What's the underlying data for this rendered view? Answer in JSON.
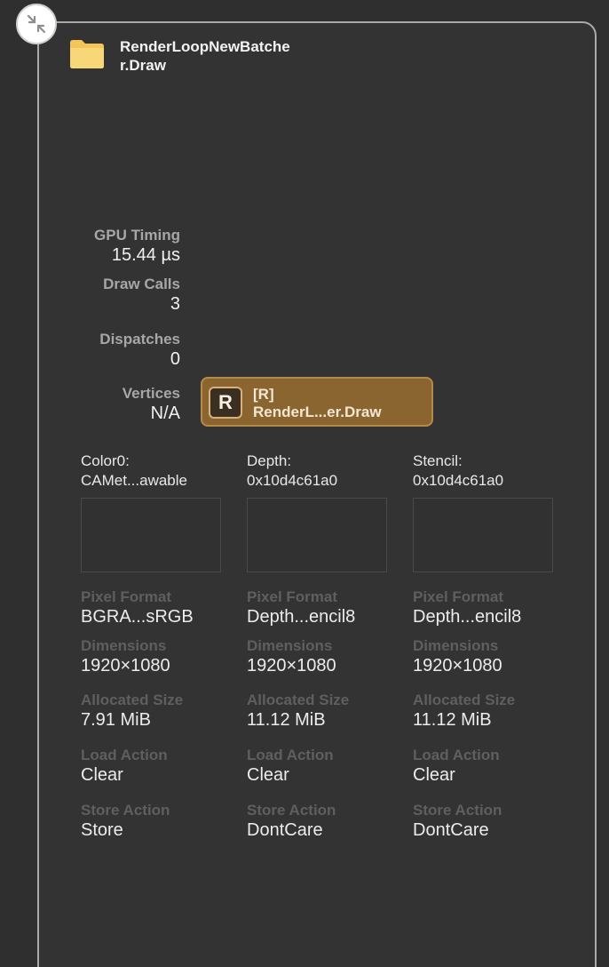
{
  "node": {
    "title": "RenderLoopNewBatcher.Draw"
  },
  "stats": [
    {
      "label": "GPU Timing",
      "value": "15.44 µs"
    },
    {
      "label": "Draw Calls",
      "value": "3"
    },
    {
      "label": "Dispatches",
      "value": "0"
    },
    {
      "label": "Vertices",
      "value": "N/A"
    }
  ],
  "badge": {
    "letter": "R",
    "line1": "[R]",
    "line2": "RenderL...er.Draw",
    "color": "#8a6530"
  },
  "attachments": [
    {
      "name_line1": "Color0:",
      "name_line2": "CAMet...awable",
      "props": [
        {
          "label": "Pixel Format",
          "value": "BGRA...sRGB"
        },
        {
          "label": "Dimensions",
          "value": "1920×1080"
        },
        {
          "label": "Allocated Size",
          "value": "7.91 MiB"
        },
        {
          "label": "Load Action",
          "value": "Clear"
        },
        {
          "label": "Store Action",
          "value": "Store"
        }
      ]
    },
    {
      "name_line1": "Depth:",
      "name_line2": "0x10d4c61a0",
      "props": [
        {
          "label": "Pixel Format",
          "value": "Depth...encil8"
        },
        {
          "label": "Dimensions",
          "value": "1920×1080"
        },
        {
          "label": "Allocated Size",
          "value": "11.12 MiB"
        },
        {
          "label": "Load Action",
          "value": "Clear"
        },
        {
          "label": "Store Action",
          "value": "DontCare"
        }
      ]
    },
    {
      "name_line1": "Stencil:",
      "name_line2": "0x10d4c61a0",
      "props": [
        {
          "label": "Pixel Format",
          "value": "Depth...encil8"
        },
        {
          "label": "Dimensions",
          "value": "1920×1080"
        },
        {
          "label": "Allocated Size",
          "value": "11.12 MiB"
        },
        {
          "label": "Load Action",
          "value": "Clear"
        },
        {
          "label": "Store Action",
          "value": "DontCare"
        }
      ]
    }
  ]
}
